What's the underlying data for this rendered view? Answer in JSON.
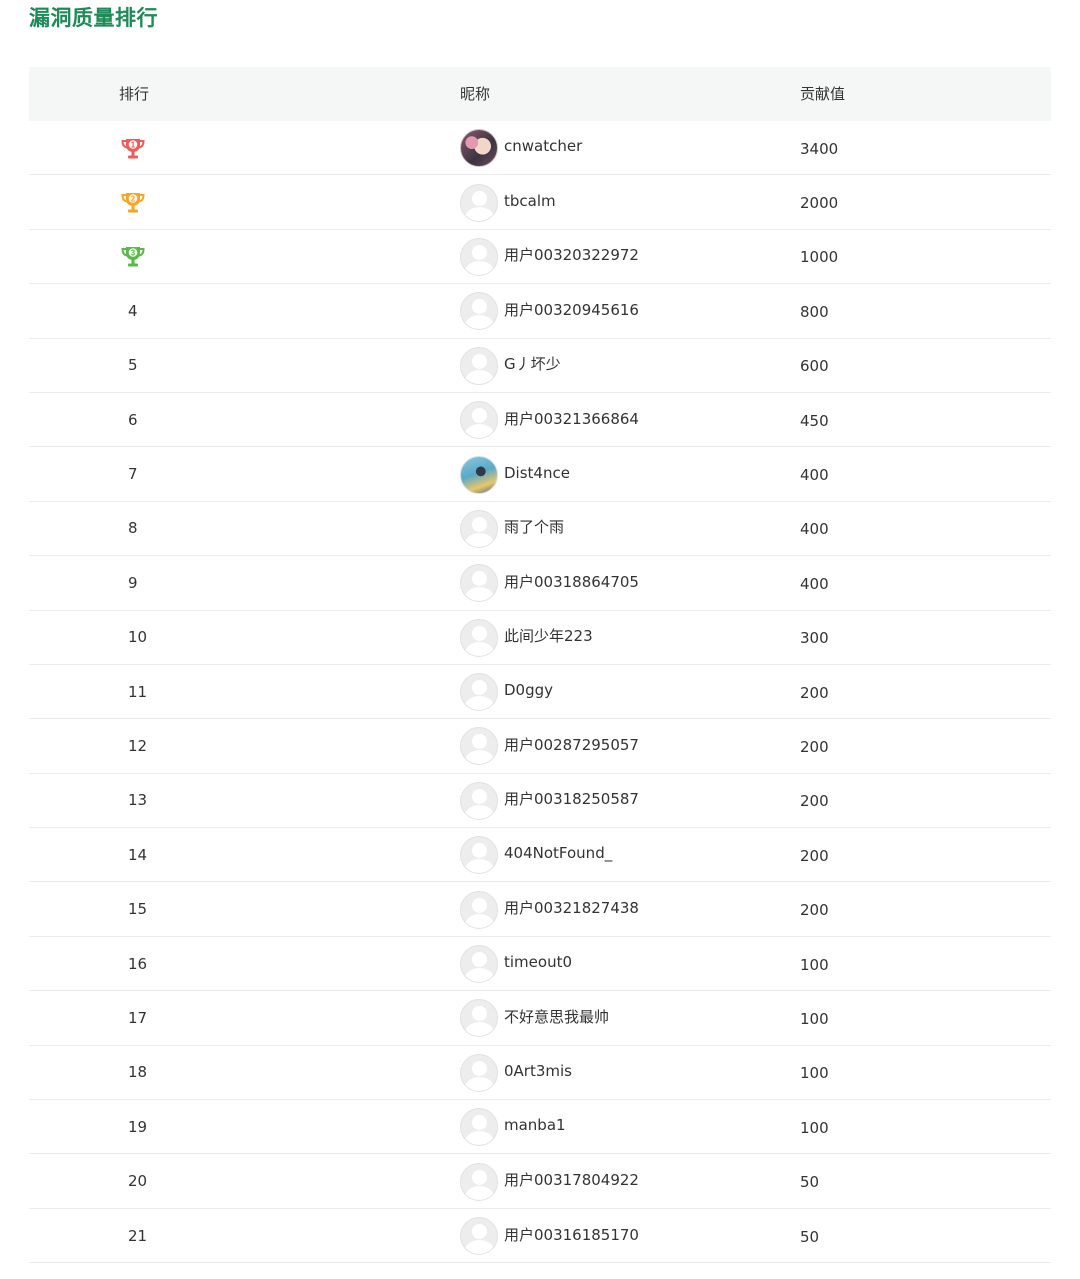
{
  "page": {
    "title": "漏洞质量排行"
  },
  "table": {
    "headers": {
      "rank": "排行",
      "nickname": "昵称",
      "score": "贡献值"
    },
    "rows": [
      {
        "rank": "1",
        "medal": "gold",
        "nickname": "cnwatcher",
        "avatar": "photo",
        "score": "3400"
      },
      {
        "rank": "2",
        "medal": "silver",
        "nickname": "tbcalm",
        "avatar": "default",
        "score": "2000"
      },
      {
        "rank": "3",
        "medal": "bronze",
        "nickname": "用户00320322972",
        "avatar": "default",
        "score": "1000"
      },
      {
        "rank": "4",
        "nickname": "用户00320945616",
        "avatar": "default",
        "score": "800"
      },
      {
        "rank": "5",
        "nickname": "G丿坏少",
        "avatar": "default",
        "score": "600"
      },
      {
        "rank": "6",
        "nickname": "用户00321366864",
        "avatar": "default",
        "score": "450"
      },
      {
        "rank": "7",
        "nickname": "Dist4nce",
        "avatar": "photo",
        "score": "400"
      },
      {
        "rank": "8",
        "nickname": "雨了个雨",
        "avatar": "default",
        "score": "400"
      },
      {
        "rank": "9",
        "nickname": "用户00318864705",
        "avatar": "default",
        "score": "400"
      },
      {
        "rank": "10",
        "nickname": "此间少年223",
        "avatar": "default",
        "score": "300"
      },
      {
        "rank": "11",
        "nickname": "D0ggy",
        "avatar": "default",
        "score": "200"
      },
      {
        "rank": "12",
        "nickname": "用户00287295057",
        "avatar": "default",
        "score": "200"
      },
      {
        "rank": "13",
        "nickname": "用户00318250587",
        "avatar": "default",
        "score": "200"
      },
      {
        "rank": "14",
        "nickname": "404NotFound_",
        "avatar": "default",
        "score": "200"
      },
      {
        "rank": "15",
        "nickname": "用户00321827438",
        "avatar": "default",
        "score": "200"
      },
      {
        "rank": "16",
        "nickname": "timeout0",
        "avatar": "default",
        "score": "100"
      },
      {
        "rank": "17",
        "nickname": "不好意思我最帅",
        "avatar": "default",
        "score": "100"
      },
      {
        "rank": "18",
        "nickname": "0Art3mis",
        "avatar": "default",
        "score": "100"
      },
      {
        "rank": "19",
        "nickname": "manba1",
        "avatar": "default",
        "score": "100"
      },
      {
        "rank": "20",
        "nickname": "用户00317804922",
        "avatar": "default",
        "score": "50"
      },
      {
        "rank": "21",
        "nickname": "用户00316185170",
        "avatar": "default",
        "score": "50"
      }
    ]
  },
  "colors": {
    "title": "#1e8a57",
    "header_bg": "#f5f7f6",
    "gold": "#f05a5a",
    "silver": "#f5a623",
    "bronze": "#58b947",
    "row_border": "#ececec",
    "avatar_bg": "#ededed"
  },
  "icons": {
    "gold": "trophy-rank-1-icon",
    "silver": "trophy-rank-2-icon",
    "bronze": "trophy-rank-3-icon",
    "default_avatar": "default-user-avatar-icon"
  }
}
